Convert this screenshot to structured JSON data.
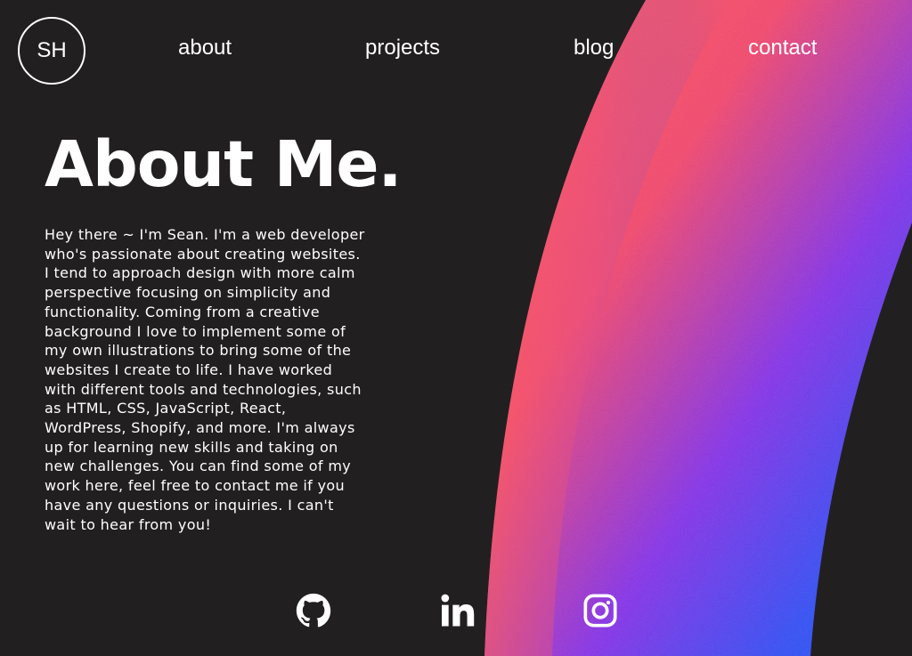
{
  "logo": {
    "text": "SH"
  },
  "nav": {
    "about": "about",
    "projects": "projects",
    "blog": "blog",
    "contact": "contact"
  },
  "main": {
    "title": "About Me.",
    "bio_lines": [
      "Hey there ~ I'm Sean. I'm a web developer",
      "who's passionate about creating websites.",
      "I tend to approach design with more calm",
      "perspective focusing on simplicity and",
      "functionality. Coming from a creative",
      "background I love to implement some of",
      "my own illustrations to bring some of the",
      "websites I create to life. I have worked",
      "with different tools and technologies, such",
      "as HTML, CSS, JavaScript, React,",
      "WordPress, Shopify, and more. I'm always",
      "up for learning new skills and taking on",
      "new challenges. You can find some of my",
      "work here, feel free to contact me if you",
      "have any questions or inquiries. I can't",
      "wait to hear from you!"
    ]
  },
  "social": [
    {
      "name": "github",
      "icon": "github-icon"
    },
    {
      "name": "linkedin",
      "icon": "linkedin-icon"
    },
    {
      "name": "instagram",
      "icon": "instagram-icon"
    }
  ],
  "colors": {
    "background": "#221f21",
    "arc_pink": "#f2575e",
    "arc_purple": "#8a3ae6",
    "arc_blue": "#2f5cf7",
    "text": "#ffffff"
  }
}
